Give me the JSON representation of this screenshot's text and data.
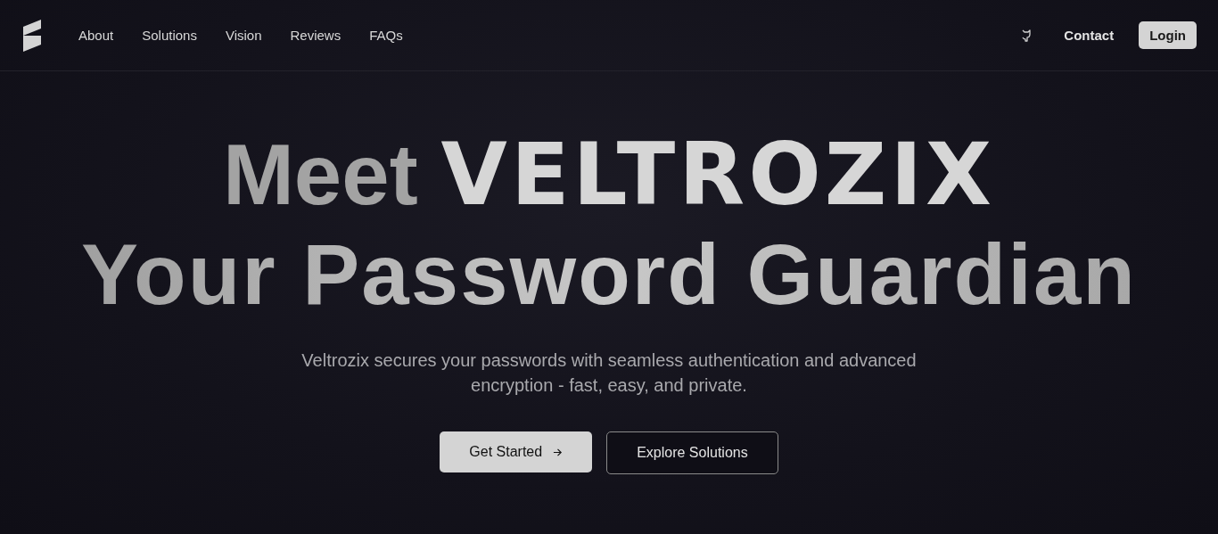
{
  "nav": {
    "links": [
      {
        "label": "About"
      },
      {
        "label": "Solutions"
      },
      {
        "label": "Vision"
      },
      {
        "label": "Reviews"
      },
      {
        "label": "FAQs"
      }
    ],
    "contact": "Contact",
    "login": "Login"
  },
  "hero": {
    "lead": "Meet",
    "brand": "VELTROZIX",
    "title": "Your Password Guardian",
    "subtitle": "Veltrozix secures your passwords with seamless authentication and advanced encryption - fast, easy, and private.",
    "buttons": [
      {
        "label": "Get Started",
        "kind": "primary"
      },
      {
        "label": "Explore Solutions",
        "kind": "outline"
      }
    ]
  }
}
